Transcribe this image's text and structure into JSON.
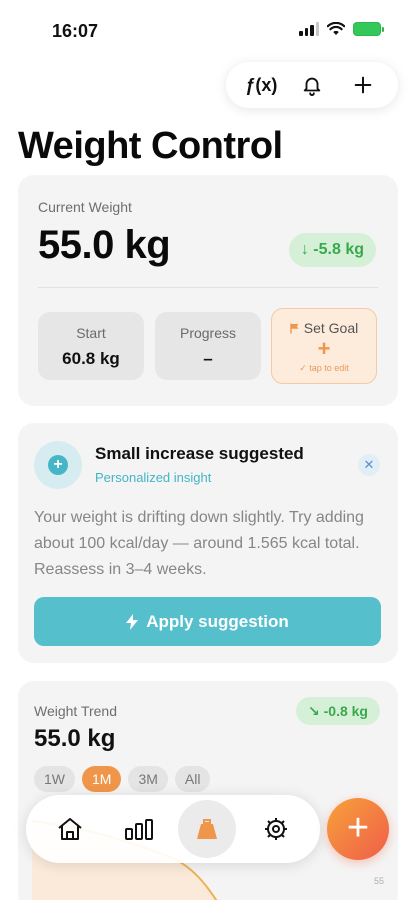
{
  "status": {
    "time": "16:07"
  },
  "toolbar": {
    "fx_label": "ƒ(x)"
  },
  "page": {
    "title": "Weight Control"
  },
  "current": {
    "label": "Current Weight",
    "value": "55.0 kg",
    "delta": "↓ -5.8 kg",
    "colors": {
      "delta_bg": "#d6f0d8",
      "delta_text": "#3aa84d"
    }
  },
  "stats": {
    "start_label": "Start",
    "start_value": "60.8 kg",
    "progress_label": "Progress",
    "progress_value": "–",
    "goal_label": "Set Goal",
    "goal_plus": "+",
    "goal_hint": "✓ tap to edit"
  },
  "insight": {
    "title": "Small increase suggested",
    "subtitle": "Personalized insight",
    "body": "Your weight is drifting down slightly. Try adding about 100 kcal/day — around 1.565 kcal total. Reassess in 3–4 weeks.",
    "button": "Apply suggestion",
    "close": "✕",
    "accent": "#55bfcc"
  },
  "trend": {
    "label": "Weight Trend",
    "value": "55.0 kg",
    "badge": "↘ -0.8 kg",
    "ranges": [
      "1W",
      "1M",
      "3M",
      "All"
    ],
    "active_range": "1M",
    "tick": "55"
  },
  "nav": {
    "items": [
      "home-icon",
      "stats-icon",
      "weight-icon",
      "settings-icon"
    ],
    "active": "weight-icon",
    "fab": "+",
    "fab_colors": [
      "#f7a23a",
      "#f05d4a"
    ]
  }
}
